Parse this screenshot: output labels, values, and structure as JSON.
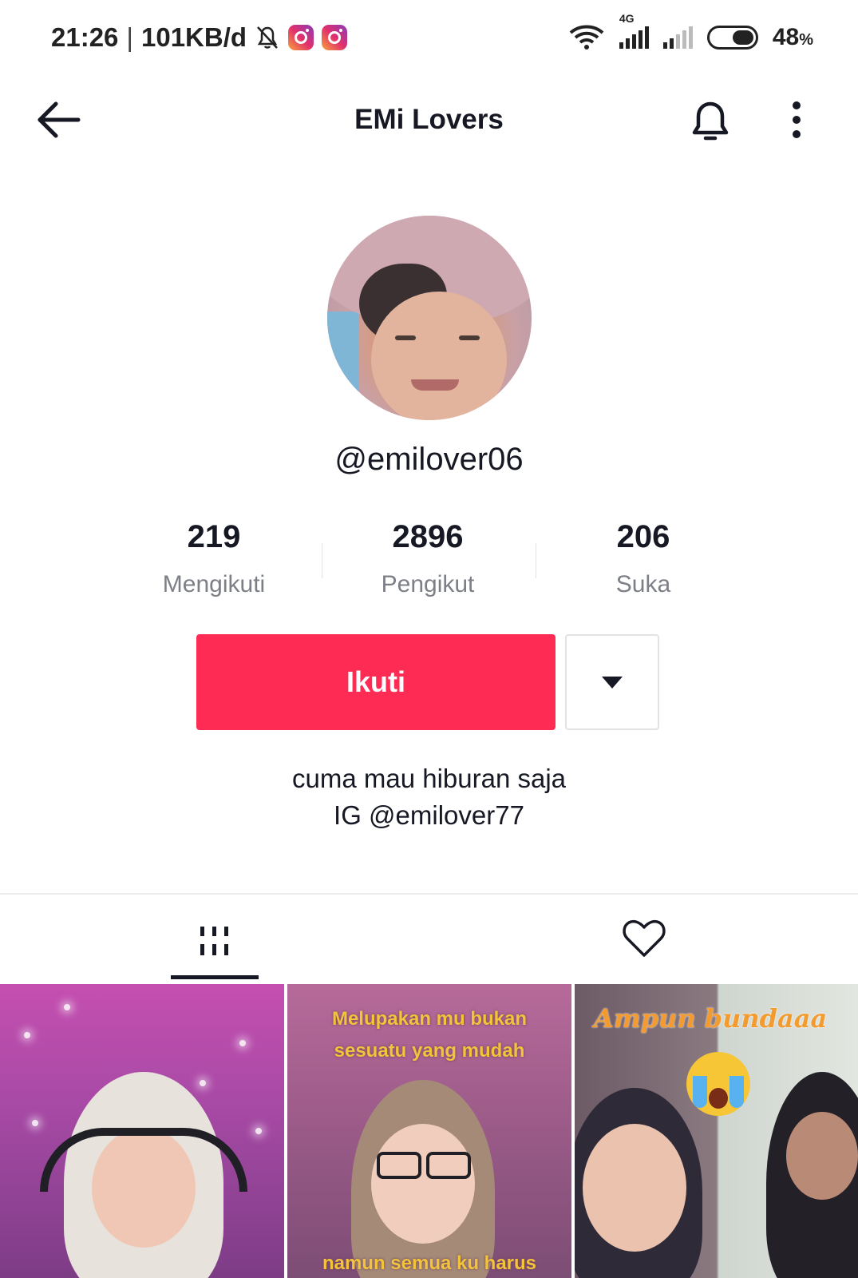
{
  "status_bar": {
    "time": "21:26",
    "separator": "|",
    "speed": "101KB/d",
    "network": "4G",
    "battery_percent": "48",
    "battery_sign": "%"
  },
  "header": {
    "title": "EMi Lovers"
  },
  "profile": {
    "username": "@emilover06",
    "stats": [
      {
        "value": "219",
        "label": "Mengikuti"
      },
      {
        "value": "2896",
        "label": "Pengikut"
      },
      {
        "value": "206",
        "label": "Suka"
      }
    ],
    "follow_label": "Ikuti",
    "bio_line1": "cuma mau hiburan saja",
    "bio_line2": "IG @emilover77"
  },
  "videos": [
    {
      "caption": ""
    },
    {
      "caption_top1": "Melupakan mu bukan",
      "caption_top2": "sesuatu yang mudah",
      "caption_bottom": "namun semua ku harus"
    },
    {
      "caption": "Ampun bundaaa"
    }
  ],
  "icons": {
    "back": "arrow-left-icon",
    "bell": "bell-icon",
    "more": "more-vertical-icon",
    "videos_tab": "grid-icon",
    "liked_tab": "heart-icon"
  },
  "colors": {
    "accent": "#fe2c55",
    "text": "#161823",
    "muted": "#7c7f86"
  }
}
